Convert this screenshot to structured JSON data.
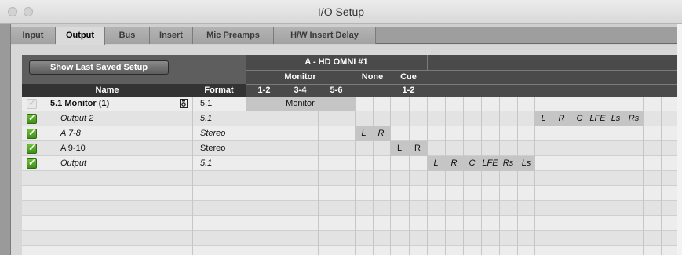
{
  "window": {
    "title": "I/O Setup"
  },
  "tabs": [
    {
      "label": "Input",
      "active": false
    },
    {
      "label": "Output",
      "active": true
    },
    {
      "label": "Bus",
      "active": false
    },
    {
      "label": "Insert",
      "active": false
    },
    {
      "label": "Mic Preamps",
      "active": false
    },
    {
      "label": "H/W Insert Delay",
      "active": false
    }
  ],
  "toolbar": {
    "show_last_saved_label": "Show Last Saved Setup"
  },
  "columns": {
    "name": "Name",
    "format": "Format"
  },
  "interface": {
    "title": "A - HD OMNI #1",
    "groups": [
      {
        "label": "Monitor",
        "subs": [
          "1-2",
          "3-4",
          "5-6"
        ]
      },
      {
        "label": "None",
        "subs": [
          ""
        ]
      },
      {
        "label": "Cue",
        "subs": [
          "1-2"
        ]
      }
    ]
  },
  "rows": [
    {
      "name": "5.1 Monitor (1)",
      "format": "5.1",
      "checked": false,
      "bold": true,
      "italic": false,
      "lock": true,
      "assignment": "Monitor"
    },
    {
      "name": "Output 2",
      "format": "5.1",
      "checked": true,
      "bold": false,
      "italic": true,
      "channels": [
        "L",
        "R",
        "C",
        "LFE",
        "Ls",
        "Rs"
      ]
    },
    {
      "name": "A 7-8",
      "format": "Stereo",
      "checked": true,
      "bold": false,
      "italic": true,
      "channels": [
        "L",
        "R"
      ]
    },
    {
      "name": "A 9-10",
      "format": "Stereo",
      "checked": true,
      "bold": false,
      "italic": false,
      "channels": [
        "L",
        "R"
      ]
    },
    {
      "name": "Output",
      "format": "5.1",
      "checked": true,
      "bold": false,
      "italic": true,
      "channels": [
        "L",
        "R",
        "C",
        "LFE",
        "Rs",
        "Ls"
      ]
    }
  ],
  "colors": {
    "checkbox_on": "#4caf26",
    "header": "#4a4a4a",
    "assignment": "#c5c5c5"
  }
}
